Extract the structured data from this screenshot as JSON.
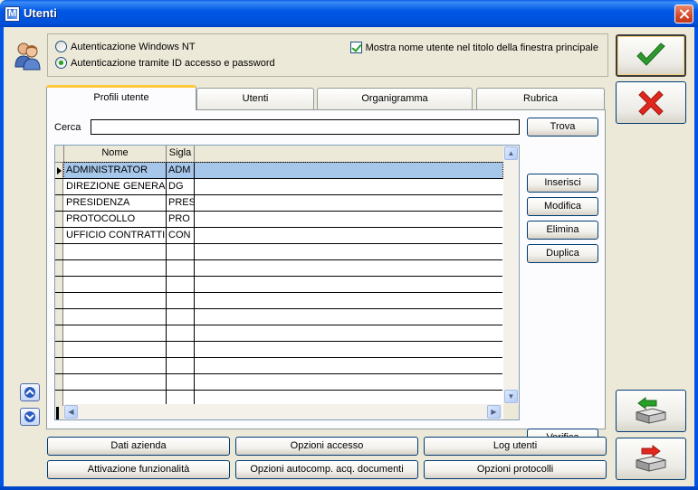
{
  "window": {
    "title": "Utenti",
    "app_icon_letter": "M"
  },
  "auth": {
    "option_windows": "Autenticazione Windows NT",
    "option_id": "Autenticazione tramite ID accesso e password",
    "selected": "option_id",
    "show_user_label": "Mostra nome utente nel titolo della finestra principale",
    "show_user_checked": true
  },
  "tabs": [
    {
      "label": "Profili utente",
      "active": true
    },
    {
      "label": "Utenti",
      "active": false
    },
    {
      "label": "Organigramma",
      "active": false
    },
    {
      "label": "Rubrica",
      "active": false
    }
  ],
  "search": {
    "label": "Cerca",
    "value": "",
    "button": "Trova"
  },
  "grid": {
    "columns": [
      "Nome",
      "Sigla"
    ],
    "rows": [
      {
        "nome": "ADMINISTRATOR",
        "sigla": "ADM",
        "selected": true
      },
      {
        "nome": "DIREZIONE GENERALE",
        "sigla": "DG",
        "selected": false
      },
      {
        "nome": "PRESIDENZA",
        "sigla": "PRES",
        "selected": false
      },
      {
        "nome": "PROTOCOLLO",
        "sigla": "PRO",
        "selected": false
      },
      {
        "nome": "UFFICIO CONTRATTI",
        "sigla": "CON",
        "selected": false
      }
    ],
    "empty_rows": 10
  },
  "side_buttons": {
    "inserisci": "Inserisci",
    "modifica": "Modifica",
    "elimina": "Elimina",
    "duplica": "Duplica",
    "verifica": "Verifica"
  },
  "bottom_buttons": {
    "dati_azienda": "Dati azienda",
    "opzioni_accesso": "Opzioni accesso",
    "log_utenti": "Log utenti",
    "attivazione": "Attivazione funzionalità",
    "opzioni_autocomp": "Opzioni autocomp. acq. documenti",
    "opzioni_protocolli": "Opzioni protocolli"
  },
  "colors": {
    "ok_check": "#2f9a2f",
    "cancel_x": "#e0281e",
    "selection": "#a6c6ea",
    "titlebar": "#0058e6"
  },
  "icons": [
    "users-icon",
    "check-icon",
    "cross-icon",
    "printer-back-icon",
    "printer-forward-icon",
    "scroll-up-icon",
    "scroll-down-icon"
  ]
}
